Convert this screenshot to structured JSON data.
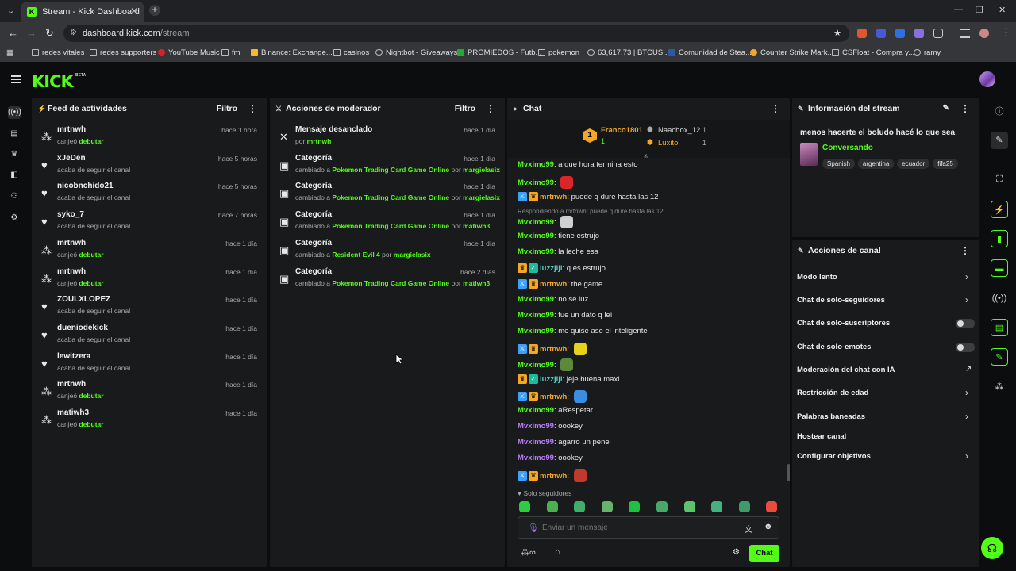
{
  "browser": {
    "tab_title": "Stream - Kick Dashboard",
    "url_host": "dashboard.kick.com",
    "url_path": "/stream"
  },
  "bookmarks": [
    "redes vitales",
    "redes supporters",
    "YouTube Music",
    "fm",
    "Binance: Exchange...",
    "casinos",
    "Nightbot - Giveaways",
    "PROMIEDOS - Futb...",
    "pokemon",
    "63,617.73 | BTCUS...",
    "Comunidad de Stea...",
    "Counter Strike Mark...",
    "CSFloat - Compra y...",
    "ramy"
  ],
  "app": {
    "logo": "KICK",
    "beta": "BETA"
  },
  "activity": {
    "title": "Feed de actividades",
    "filter": "Filtro",
    "items": [
      {
        "name": "mrtnwh",
        "pre": "canjeó ",
        "hl": "debutar",
        "time": "hace 1 hora",
        "icon": "redeem"
      },
      {
        "name": "xJeDen",
        "pre": "acaba de seguir el canal",
        "hl": "",
        "time": "hace 5 horas",
        "icon": "heart"
      },
      {
        "name": "nicobnchido21",
        "pre": "acaba de seguir el canal",
        "hl": "",
        "time": "hace 5 horas",
        "icon": "heart"
      },
      {
        "name": "syko_7",
        "pre": "acaba de seguir el canal",
        "hl": "",
        "time": "hace 7 horas",
        "icon": "heart"
      },
      {
        "name": "mrtnwh",
        "pre": "canjeó ",
        "hl": "debutar",
        "time": "hace 1 día",
        "icon": "redeem"
      },
      {
        "name": "mrtnwh",
        "pre": "canjeó ",
        "hl": "debutar",
        "time": "hace 1 día",
        "icon": "redeem"
      },
      {
        "name": "ZOULXLOPEZ",
        "pre": "acaba de seguir el canal",
        "hl": "",
        "time": "hace 1 día",
        "icon": "heart"
      },
      {
        "name": "dueniodekick",
        "pre": "acaba de seguir el canal",
        "hl": "",
        "time": "hace 1 día",
        "icon": "heart"
      },
      {
        "name": "lewitzera",
        "pre": "acaba de seguir el canal",
        "hl": "",
        "time": "hace 1 día",
        "icon": "heart"
      },
      {
        "name": "mrtnwh",
        "pre": "canjeó ",
        "hl": "debutar",
        "time": "hace 1 día",
        "icon": "redeem"
      },
      {
        "name": "matiwh3",
        "pre": "canjeó ",
        "hl": "debutar",
        "time": "hace 1 día",
        "icon": "redeem"
      }
    ]
  },
  "modactions": {
    "title": "Acciones de moderador",
    "filter": "Filtro",
    "items": [
      {
        "title": "Mensaje desanclado",
        "parts": [
          [
            "por ",
            false
          ],
          [
            "mrtnwh",
            true
          ]
        ],
        "time": "hace 1 día"
      },
      {
        "title": "Categoría",
        "parts": [
          [
            "cambiado a ",
            false
          ],
          [
            "Pokemon Trading Card Game Online",
            true
          ],
          [
            " por ",
            false
          ],
          [
            "margielasix",
            true
          ]
        ],
        "time": "hace 1 día"
      },
      {
        "title": "Categoría",
        "parts": [
          [
            "cambiado a ",
            false
          ],
          [
            "Pokemon Trading Card Game Online",
            true
          ],
          [
            " por ",
            false
          ],
          [
            "margielasix",
            true
          ]
        ],
        "time": "hace 1 día"
      },
      {
        "title": "Categoría",
        "parts": [
          [
            "cambiado a ",
            false
          ],
          [
            "Pokemon Trading Card Game Online",
            true
          ],
          [
            " por ",
            false
          ],
          [
            "matiwh3",
            true
          ]
        ],
        "time": "hace 1 día"
      },
      {
        "title": "Categoría",
        "parts": [
          [
            "cambiado a ",
            false
          ],
          [
            "Resident Evil 4",
            true
          ],
          [
            " por ",
            false
          ],
          [
            "margielasix",
            true
          ]
        ],
        "time": "hace 1 día"
      },
      {
        "title": "Categoría",
        "parts": [
          [
            "cambiado a ",
            false
          ],
          [
            "Pokemon Trading Card Game Online",
            true
          ],
          [
            " por ",
            false
          ],
          [
            "matiwh3",
            true
          ]
        ],
        "time": "hace 2 días"
      }
    ]
  },
  "chat": {
    "title": "Chat",
    "leaderboard": [
      {
        "name": "Franco1801",
        "count": "1",
        "rank": "1"
      },
      {
        "name": "Naachox_12",
        "count": "1"
      },
      {
        "name": "Luxito",
        "count": "1"
      }
    ],
    "reply_note": "Respondiendo a mrtnwh: puede q dure hasta las 12",
    "messages": [
      {
        "user": "Mvximo99",
        "color": "green",
        "badges": [],
        "text": "a que hora termina esto",
        "emote": ""
      },
      {
        "user": "Mvximo99",
        "color": "green",
        "badges": [],
        "text": "",
        "emote": "#d9262b"
      },
      {
        "user": "mrtnwh",
        "color": "orange",
        "badges": [
          "mod",
          "own"
        ],
        "text": "puede q dure hasta las 12",
        "emote": ""
      },
      {
        "user": "Mvximo99",
        "color": "green",
        "badges": [],
        "text": "",
        "emote": "#cfcfcf"
      },
      {
        "user": "Mvximo99",
        "color": "green",
        "badges": [],
        "text": "tiene estrujo",
        "emote": ""
      },
      {
        "user": "Mvximo99",
        "color": "green",
        "badges": [],
        "text": "la leche esa",
        "emote": ""
      },
      {
        "user": "luzzjiji",
        "color": "cyan",
        "badges": [
          "own",
          "v"
        ],
        "text": "q es estrujo",
        "emote": ""
      },
      {
        "user": "mrtnwh",
        "color": "orange",
        "badges": [
          "mod",
          "own"
        ],
        "text": "the game",
        "emote": ""
      },
      {
        "user": "Mvximo99",
        "color": "green",
        "badges": [],
        "text": "no sé luz",
        "emote": ""
      },
      {
        "user": "Mvximo99",
        "color": "green",
        "badges": [],
        "text": "fue un dato q leí",
        "emote": ""
      },
      {
        "user": "Mvximo99",
        "color": "green",
        "badges": [],
        "text": "me quise ase el inteligente",
        "emote": ""
      },
      {
        "user": "mrtnwh",
        "color": "orange",
        "badges": [
          "mod",
          "own"
        ],
        "text": "",
        "emote": "#e6d21c"
      },
      {
        "user": "Mvximo99",
        "color": "green",
        "badges": [],
        "text": "",
        "emote": "#5b8a3c"
      },
      {
        "user": "luzzjiji",
        "color": "cyan",
        "badges": [
          "own",
          "v"
        ],
        "text": "jeje buena maxi",
        "emote": ""
      },
      {
        "user": "mrtnwh",
        "color": "orange",
        "badges": [
          "mod",
          "own"
        ],
        "text": "",
        "emote": "#3a8de0"
      },
      {
        "user": "Mvximo99",
        "color": "green",
        "badges": [],
        "text": "aRespetar",
        "emote": ""
      },
      {
        "user": "Mvximo99",
        "color": "purple",
        "badges": [],
        "text": "oookey",
        "emote": ""
      },
      {
        "user": "Mvximo99",
        "color": "purple",
        "badges": [],
        "text": "agarro un pene",
        "emote": ""
      },
      {
        "user": "Mvximo99",
        "color": "purple",
        "badges": [],
        "text": "oookey",
        "emote": ""
      },
      {
        "user": "mrtnwh",
        "color": "orange",
        "badges": [
          "mod",
          "own"
        ],
        "text": "",
        "emote": "#c0392b"
      }
    ],
    "followers_only": "Solo seguidores",
    "input_placeholder": "Enviar un mensaje",
    "send": "Chat",
    "emote_colors": [
      "#2ecc40",
      "#4caf50",
      "#3fae6b",
      "#67b36a",
      "#20c040",
      "#48a868",
      "#5cc46b",
      "#45b080",
      "#3f9c6a",
      "#e74c3c"
    ]
  },
  "streaminfo": {
    "title": "Información del stream",
    "stream_title": "menos hacerte el boludo hacé lo que sea",
    "category": "Conversando",
    "tags": [
      "Spanish",
      "argentina",
      "ecuador",
      "fifa25"
    ]
  },
  "channel": {
    "title": "Acciones de canal",
    "rows": [
      {
        "label": "Modo lento",
        "ctl": "chev"
      },
      {
        "label": "Chat de solo-seguidores",
        "ctl": "chev"
      },
      {
        "label": "Chat de solo-suscriptores",
        "ctl": "toggle"
      },
      {
        "label": "Chat de solo-emotes",
        "ctl": "toggle"
      },
      {
        "label": "Moderación del chat con IA",
        "ctl": "ext"
      },
      {
        "label": "Restricción de edad",
        "ctl": "chev"
      },
      {
        "label": "Palabras baneadas",
        "ctl": "chev"
      },
      {
        "label": "Hostear canal",
        "ctl": ""
      },
      {
        "label": "Configurar objetivos",
        "ctl": "chev"
      }
    ]
  }
}
